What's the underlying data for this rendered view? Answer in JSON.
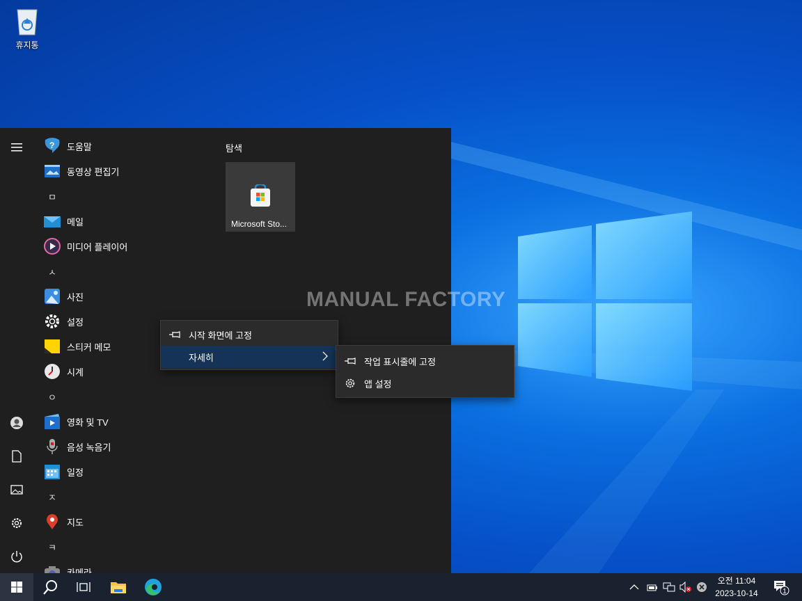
{
  "desktop": {
    "recycle_bin_label": "휴지통",
    "watermark": "MANUAL FACTORY"
  },
  "start_menu": {
    "apps": [
      {
        "type": "app",
        "label": "도움말",
        "icon": "help-icon"
      },
      {
        "type": "app",
        "label": "동영상 편집기",
        "icon": "video-editor-icon"
      },
      {
        "type": "letter",
        "label": "ㅁ"
      },
      {
        "type": "app",
        "label": "메일",
        "icon": "mail-icon"
      },
      {
        "type": "app",
        "label": "미디어 플레이어",
        "icon": "media-player-icon"
      },
      {
        "type": "letter",
        "label": "ㅅ"
      },
      {
        "type": "app",
        "label": "사진",
        "icon": "photos-icon"
      },
      {
        "type": "app",
        "label": "설정",
        "icon": "settings-icon"
      },
      {
        "type": "app",
        "label": "스티커 메모",
        "icon": "sticky-notes-icon"
      },
      {
        "type": "app",
        "label": "시계",
        "icon": "clock-icon"
      },
      {
        "type": "letter",
        "label": "ㅇ"
      },
      {
        "type": "app",
        "label": "영화 및 TV",
        "icon": "movies-tv-icon"
      },
      {
        "type": "app",
        "label": "음성 녹음기",
        "icon": "voice-recorder-icon"
      },
      {
        "type": "app",
        "label": "일정",
        "icon": "calendar-icon"
      },
      {
        "type": "letter",
        "label": "ㅈ"
      },
      {
        "type": "app",
        "label": "지도",
        "icon": "maps-icon"
      },
      {
        "type": "letter",
        "label": "ㅋ"
      },
      {
        "type": "app",
        "label": "카메라",
        "icon": "camera-icon"
      }
    ],
    "tile_group_label": "탐색",
    "tile": {
      "label": "Microsoft Sto...",
      "icon": "microsoft-store-icon"
    },
    "rail_icons": [
      "hamburger-menu-icon",
      "user-icon",
      "documents-icon",
      "pictures-icon",
      "settings-gear-icon",
      "power-icon"
    ]
  },
  "context_menu": {
    "pin_to_start": "시작 화면에 고정",
    "more": "자세히"
  },
  "submenu": {
    "pin_to_taskbar": "작업 표시줄에 고정",
    "app_settings": "앱 설정"
  },
  "taskbar": {
    "time": "오전 11:04",
    "date": "2023-10-14",
    "notification_count": "1"
  },
  "colors": {
    "start_bg": "#1f1f1f",
    "menu_highlight": "#153357",
    "taskbar_bg": "#1a2230",
    "accent": "#0078d7"
  }
}
